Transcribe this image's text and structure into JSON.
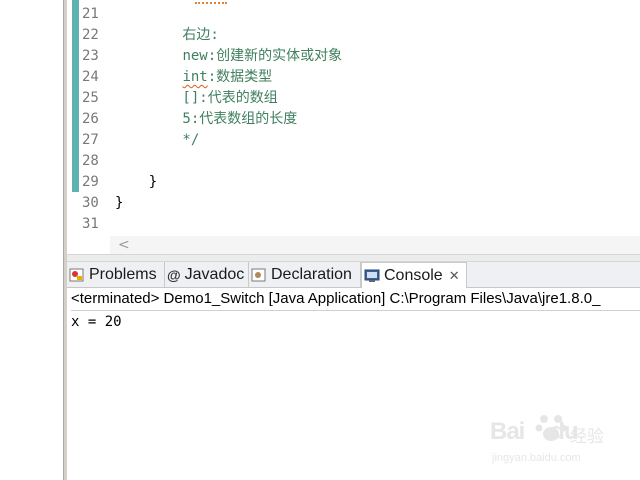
{
  "editor": {
    "lines": [
      {
        "num": "21",
        "text": ""
      },
      {
        "num": "22",
        "text": "        右边:"
      },
      {
        "num": "23",
        "prefix": "        ",
        "squiggle": "",
        "text": "new:创建新的实体或对象"
      },
      {
        "num": "24",
        "prefix": "        ",
        "squiggle": "int",
        "text": ":数据类型"
      },
      {
        "num": "25",
        "text": "        []:代表的数组"
      },
      {
        "num": "26",
        "text": "        5:代表数组的长度"
      },
      {
        "num": "27",
        "text": "        */"
      },
      {
        "num": "28",
        "text": ""
      },
      {
        "num": "29",
        "text": "    }"
      },
      {
        "num": "30",
        "text": "}"
      },
      {
        "num": "31",
        "text": ""
      }
    ],
    "scroll_left_glyph": "<"
  },
  "tabs": [
    {
      "label": "Problems",
      "icon": "problems-icon"
    },
    {
      "label": "Javadoc",
      "icon": "javadoc-icon",
      "glyph": "@"
    },
    {
      "label": "Declaration",
      "icon": "declaration-icon"
    },
    {
      "label": "Console",
      "icon": "console-icon",
      "active": true,
      "close_glyph": "✕"
    }
  ],
  "console": {
    "header": "<terminated> Demo1_Switch [Java Application] C:\\Program Files\\Java\\jre1.8.0_",
    "output": "x = 20"
  },
  "watermark": {
    "brand": "Bai",
    "brand2": "du",
    "cn": "经验",
    "url": "jingyan.baidu.com"
  },
  "colors": {
    "comment": "#3f7f5f",
    "change_bar": "#5eb3b0",
    "squiggle": "#e05a1e"
  }
}
